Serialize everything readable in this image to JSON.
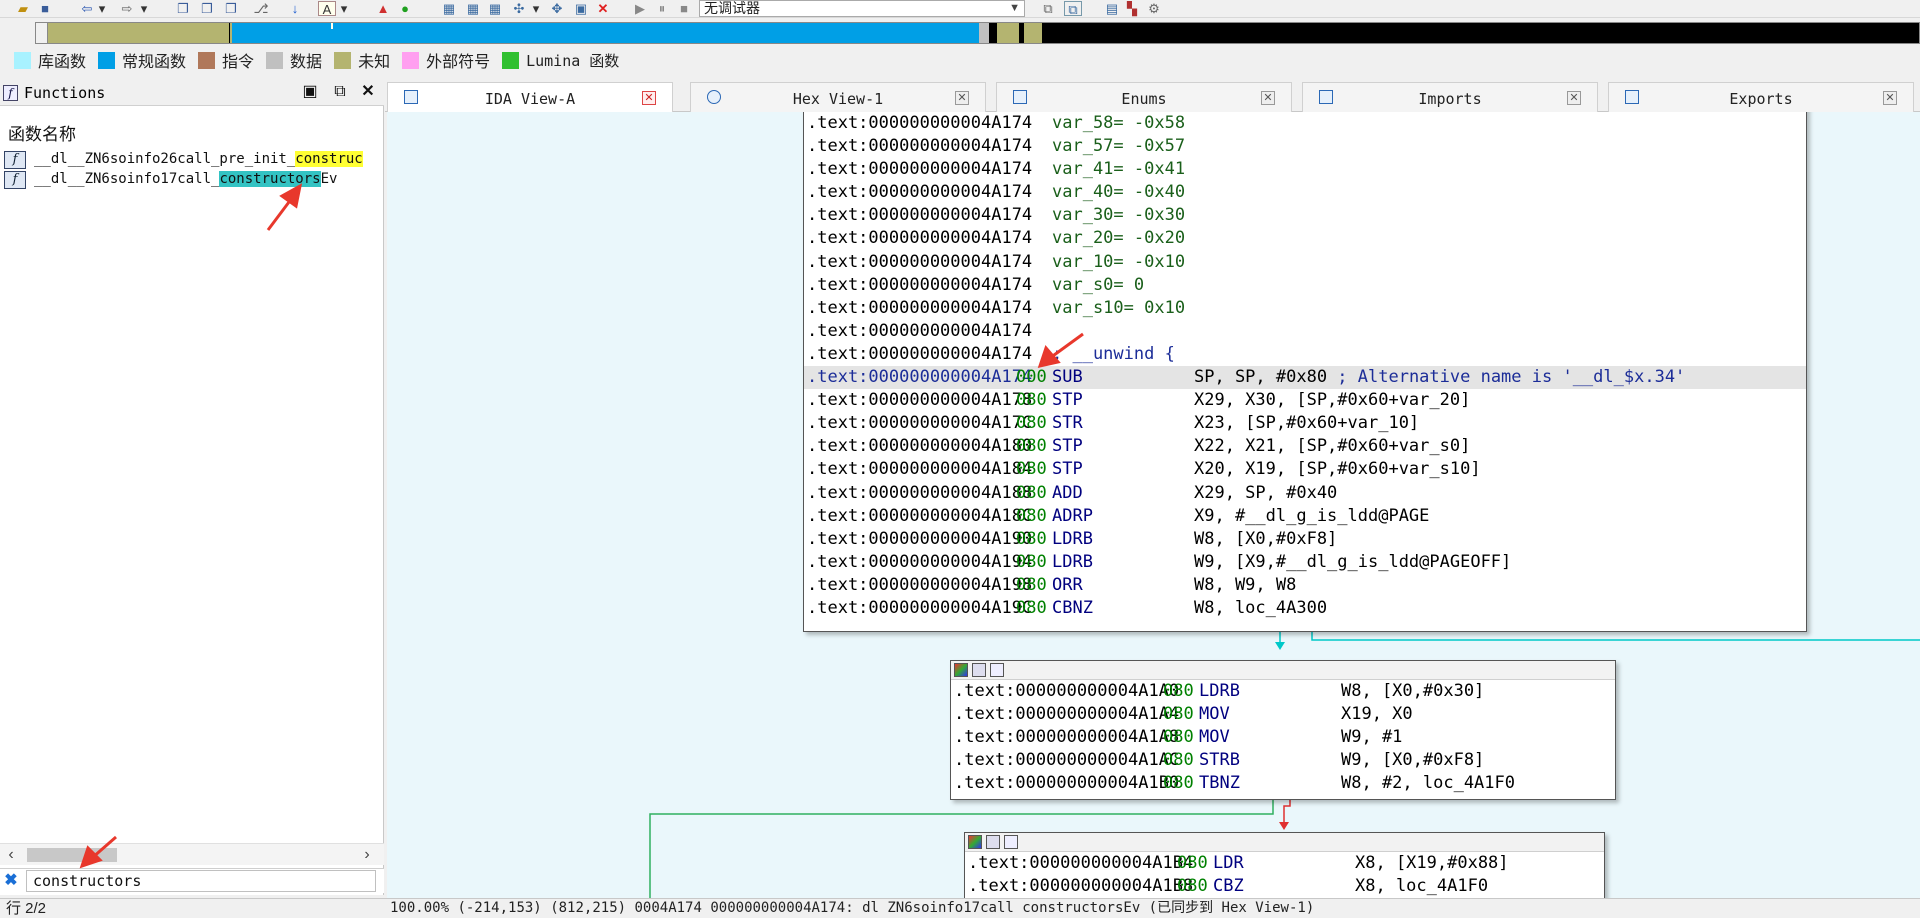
{
  "toolbar": {
    "debugger_select": "无调试器",
    "icons": [
      "open-icon",
      "save-icon",
      "back-icon",
      "forward-icon",
      "copy-icon",
      "paste-icon",
      "jump-icon",
      "download-icon",
      "text-icon",
      "warning-icon",
      "run-icon",
      "graph-icon",
      "close-red-icon",
      "play-icon",
      "pause-icon",
      "stop-icon"
    ]
  },
  "legend": [
    {
      "label": "库函数",
      "color": "#a8f2ff"
    },
    {
      "label": "常规函数",
      "color": "#009fe6"
    },
    {
      "label": "指令",
      "color": "#b0785a"
    },
    {
      "label": "数据",
      "color": "#c0c0c0"
    },
    {
      "label": "未知",
      "color": "#b4b470"
    },
    {
      "label": "外部符号",
      "color": "#ff9ff0"
    },
    {
      "label": "Lumina 函数",
      "color": "#30c030"
    }
  ],
  "functions": {
    "title": "Functions",
    "column_header": "函数名称",
    "items": [
      {
        "prefix": "__dl__ZN6soinfo26call_pre_init_",
        "match": "construc",
        "suffix": ""
      },
      {
        "prefix": "__dl__ZN6soinfo17call_",
        "match": "constructors",
        "suffix": "Ev"
      }
    ],
    "search_value": "constructors",
    "row_count": "行 2/2"
  },
  "tabs": [
    {
      "label": "IDA View-A",
      "active": true
    },
    {
      "label": "Hex View-1",
      "active": false
    },
    {
      "label": "Enums",
      "active": false
    },
    {
      "label": "Imports",
      "active": false
    },
    {
      "label": "Exports",
      "active": false
    }
  ],
  "graph": {
    "node1": [
      {
        "addr": ".text:000000000004A174",
        "sp": "",
        "mn": "",
        "op": "var_58= -0x58"
      },
      {
        "addr": ".text:000000000004A174",
        "sp": "",
        "mn": "",
        "op": "var_57= -0x57"
      },
      {
        "addr": ".text:000000000004A174",
        "sp": "",
        "mn": "",
        "op": "var_41= -0x41"
      },
      {
        "addr": ".text:000000000004A174",
        "sp": "",
        "mn": "",
        "op": "var_40= -0x40"
      },
      {
        "addr": ".text:000000000004A174",
        "sp": "",
        "mn": "",
        "op": "var_30= -0x30"
      },
      {
        "addr": ".text:000000000004A174",
        "sp": "",
        "mn": "",
        "op": "var_20= -0x20"
      },
      {
        "addr": ".text:000000000004A174",
        "sp": "",
        "mn": "",
        "op": "var_10= -0x10"
      },
      {
        "addr": ".text:000000000004A174",
        "sp": "",
        "mn": "",
        "op": "var_s0=  0"
      },
      {
        "addr": ".text:000000000004A174",
        "sp": "",
        "mn": "",
        "op": "var_s10=  0x10"
      },
      {
        "addr": ".text:000000000004A174",
        "sp": "",
        "mn": "",
        "op": ""
      },
      {
        "addr": ".text:000000000004A174",
        "sp": "",
        "mn": "",
        "op": "; __unwind {"
      },
      {
        "addr": ".text:000000000004A174",
        "sp": "000",
        "mn": "SUB",
        "op": "SP, SP, #0x80 ; Alternative name is '__dl_$x.34'"
      },
      {
        "addr": ".text:000000000004A178",
        "sp": "080",
        "mn": "STP",
        "op": "X29, X30, [SP,#0x60+var_20]"
      },
      {
        "addr": ".text:000000000004A17C",
        "sp": "080",
        "mn": "STR",
        "op": "X23, [SP,#0x60+var_10]"
      },
      {
        "addr": ".text:000000000004A180",
        "sp": "080",
        "mn": "STP",
        "op": "X22, X21, [SP,#0x60+var_s0]"
      },
      {
        "addr": ".text:000000000004A184",
        "sp": "080",
        "mn": "STP",
        "op": "X20, X19, [SP,#0x60+var_s10]"
      },
      {
        "addr": ".text:000000000004A188",
        "sp": "080",
        "mn": "ADD",
        "op": "X29, SP, #0x40"
      },
      {
        "addr": ".text:000000000004A18C",
        "sp": "080",
        "mn": "ADRP",
        "op": "X9, #__dl_g_is_ldd@PAGE"
      },
      {
        "addr": ".text:000000000004A190",
        "sp": "080",
        "mn": "LDRB",
        "op": "W8, [X0,#0xF8]"
      },
      {
        "addr": ".text:000000000004A194",
        "sp": "080",
        "mn": "LDRB",
        "op": "W9, [X9,#__dl_g_is_ldd@PAGEOFF]"
      },
      {
        "addr": ".text:000000000004A198",
        "sp": "080",
        "mn": "ORR",
        "op": "W8, W9, W8"
      },
      {
        "addr": ".text:000000000004A19C",
        "sp": "080",
        "mn": "CBNZ",
        "op": "W8, loc_4A300"
      }
    ],
    "node2": [
      {
        "addr": ".text:000000000004A1A0",
        "sp": "080",
        "mn": "LDRB",
        "op": "W8, [X0,#0x30]"
      },
      {
        "addr": ".text:000000000004A1A4",
        "sp": "080",
        "mn": "MOV",
        "op": "X19, X0"
      },
      {
        "addr": ".text:000000000004A1A8",
        "sp": "080",
        "mn": "MOV",
        "op": "W9, #1"
      },
      {
        "addr": ".text:000000000004A1AC",
        "sp": "080",
        "mn": "STRB",
        "op": "W9, [X0,#0xF8]"
      },
      {
        "addr": ".text:000000000004A1B0",
        "sp": "080",
        "mn": "TBNZ",
        "op": "W8, #2, loc_4A1F0"
      }
    ],
    "node3": [
      {
        "addr": ".text:000000000004A1B4",
        "sp": "080",
        "mn": "LDR",
        "op": "X8, [X19,#0x88]"
      },
      {
        "addr": ".text:000000000004A1B8",
        "sp": "080",
        "mn": "CBZ",
        "op": "X8, loc_4A1F0"
      }
    ]
  },
  "status": {
    "zoom": "100.00%",
    "graph_pos": "(-214,153)",
    "mouse_pos": "(812,215)",
    "offset": "0004A174",
    "location": "000000000004A174:",
    "func_label": "dl  ZN6soinfo17call constructorsEv (已同步到 Hex View-1)"
  }
}
